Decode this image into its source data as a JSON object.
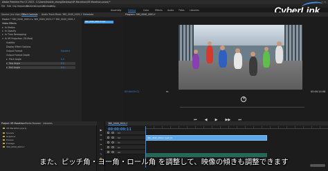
{
  "window": {
    "title": "Adobe Premiere Pro CC 2015 - C:\\Users\\frankie_zhang\\Desktop\\VR Marathon\\VR Marathon.prproj *"
  },
  "menu": [
    "File",
    "Edit",
    "Clip",
    "Sequence",
    "Markers",
    "Graphics",
    "Window",
    "Help"
  ],
  "workspaces": [
    {
      "label": "Assembly",
      "active": false
    },
    {
      "label": "Editing",
      "active": true
    },
    {
      "label": "Color",
      "active": false
    },
    {
      "label": "Effects",
      "active": false
    },
    {
      "label": "Audio",
      "active": false
    },
    {
      "label": "Titles",
      "active": false
    },
    {
      "label": "Libraries",
      "active": false
    }
  ],
  "effect_controls": {
    "tabs": [
      "Source: (no clips)",
      "Effect Controls",
      "Audio Track Mixer: 360_0040_0001-f",
      "Metadata"
    ],
    "clip_path": "Master * 360_0040_0001-f ▸ 360_0040_0001-f * 360_0040_0001-f",
    "section": "Video Effects",
    "properties": [
      {
        "label": "fx  Motion"
      },
      {
        "label": "fx  Opacity"
      },
      {
        "label": "fx  Time Remapping"
      },
      {
        "label": "fx  VR Projection (TA-Mod)"
      },
      {
        "label": "Subtitle",
        "indent": true
      },
      {
        "label": "Display Effect Options",
        "indent": true
      },
      {
        "label": "Output Format",
        "indent": true,
        "value": "Equirect"
      },
      {
        "label": "Output Format Depth",
        "indent": true
      },
      {
        "label": "Pitch Angle",
        "indent": true,
        "value": "0.0"
      },
      {
        "label": "Yaw Angle",
        "indent": true,
        "value": "0.0",
        "selected": true
      },
      {
        "label": "Roll Angle",
        "indent": true,
        "value": "0.0",
        "selected": true
      }
    ],
    "mini_clip": "360_0040_0001-f.mp4"
  },
  "program": {
    "title": "Program: 360_0040_0001-f",
    "timecode_left": "00:00:09:11",
    "fit": "Fit",
    "timecode_right": "00:00:14:06",
    "transport": [
      "⏮",
      "◀",
      "▶",
      "▶▶",
      "⏭"
    ]
  },
  "project": {
    "tabs": [
      "Project: VR Marathon",
      "Media Browser",
      "Libraries"
    ],
    "bins": [
      "VR Marathon.prproj",
      "Sounds",
      "Graphics",
      "Proxies",
      "Footage",
      "360_0040_0001-f"
    ]
  },
  "tools": [
    "▶",
    "⇔",
    "↔",
    "✂",
    "⇥",
    "✎",
    "✋",
    "T"
  ],
  "timeline": {
    "tabs": [
      "360_0040_0001-f"
    ],
    "timecode": "00:00:09:11",
    "tracks": [
      "V3",
      "V2",
      "V1",
      "A1",
      "A2",
      "A3"
    ],
    "clip_label": "360_0040_0001-f.mp4 [V]"
  },
  "logo": "CyberLink",
  "subtitle": "また、ピッチ角・ヨー角・ロール角 を調整して、映像の傾きも調整できます",
  "colors": {
    "accent": "#3d8ee8",
    "clip": "#5ba5e8"
  }
}
